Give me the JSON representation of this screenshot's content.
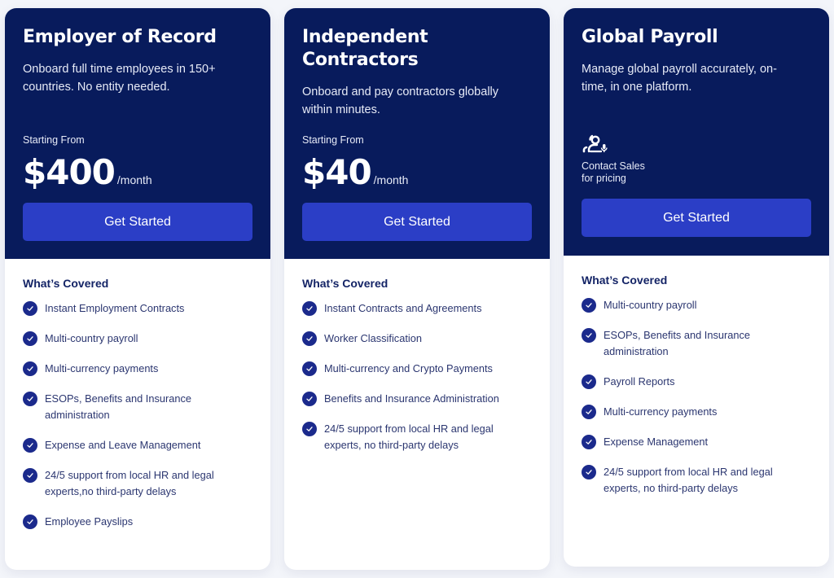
{
  "colors": {
    "header_bg": "#081b5c",
    "button_bg": "#2b3ec6",
    "check_bg": "#1b2a8c",
    "page_bg": "#f3f5fa"
  },
  "plans": [
    {
      "title": "Employer of Record",
      "description": "Onboard full time employees in 150+ countries. No entity needed.",
      "starting_label": "Starting From",
      "price": "$400",
      "period": "/month",
      "cta": "Get Started",
      "covered_heading": "What’s Covered",
      "features": [
        "Instant Employment Contracts",
        "Multi-country payroll",
        "Multi-currency payments",
        "ESOPs, Benefits and Insurance administration",
        "Expense and Leave Management",
        "24/5 support from local HR and legal experts,no third-party delays",
        "Employee Payslips"
      ]
    },
    {
      "title": "Independent Contractors",
      "description": "Onboard and pay contractors globally within minutes.",
      "starting_label": "Starting From",
      "price": "$40",
      "period": "/month",
      "cta": "Get Started",
      "covered_heading": "What’s Covered",
      "features": [
        "Instant Contracts and Agreements",
        "Worker Classification",
        "Multi-currency and Crypto Payments",
        "Benefits and Insurance Administration",
        "24/5 support from local HR and legal experts, no third-party delays"
      ]
    },
    {
      "title": "Global Payroll",
      "description": "Manage global payroll accurately, on-time, in one platform.",
      "contact_icon": "contact-sales-icon",
      "contact_line1": "Contact Sales",
      "contact_line2": "for pricing",
      "cta": "Get Started",
      "covered_heading": "What’s Covered",
      "features": [
        "Multi-country payroll",
        "ESOPs, Benefits and Insurance administration",
        "Payroll Reports",
        "Multi-currency payments",
        "Expense Management",
        "24/5 support from local HR and legal experts, no third-party delays"
      ]
    }
  ]
}
